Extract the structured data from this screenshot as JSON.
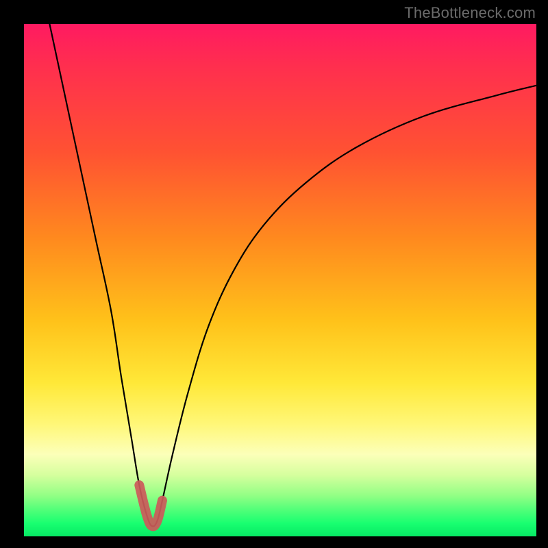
{
  "watermark": "TheBottleneck.com",
  "chart_data": {
    "type": "line",
    "title": "",
    "xlabel": "",
    "ylabel": "",
    "xlim": [
      0,
      100
    ],
    "ylim": [
      0,
      100
    ],
    "grid": false,
    "legend": false,
    "series": [
      {
        "name": "bottleneck-curve",
        "x": [
          5,
          8,
          11,
          14,
          17,
          19,
          21,
          22.5,
          24,
          25,
          26,
          27,
          29,
          32,
          36,
          41,
          47,
          55,
          65,
          78,
          92,
          100
        ],
        "y": [
          100,
          86,
          72,
          58,
          44,
          31,
          19,
          10,
          4,
          2,
          3,
          7,
          16,
          28,
          41,
          52,
          61,
          69,
          76,
          82,
          86,
          88
        ]
      }
    ],
    "annotations": [
      {
        "type": "highlight-segment",
        "name": "valley-highlight",
        "color": "#cc5a5a",
        "x_range": [
          22.5,
          27
        ],
        "y_range": [
          2,
          10
        ]
      }
    ]
  }
}
